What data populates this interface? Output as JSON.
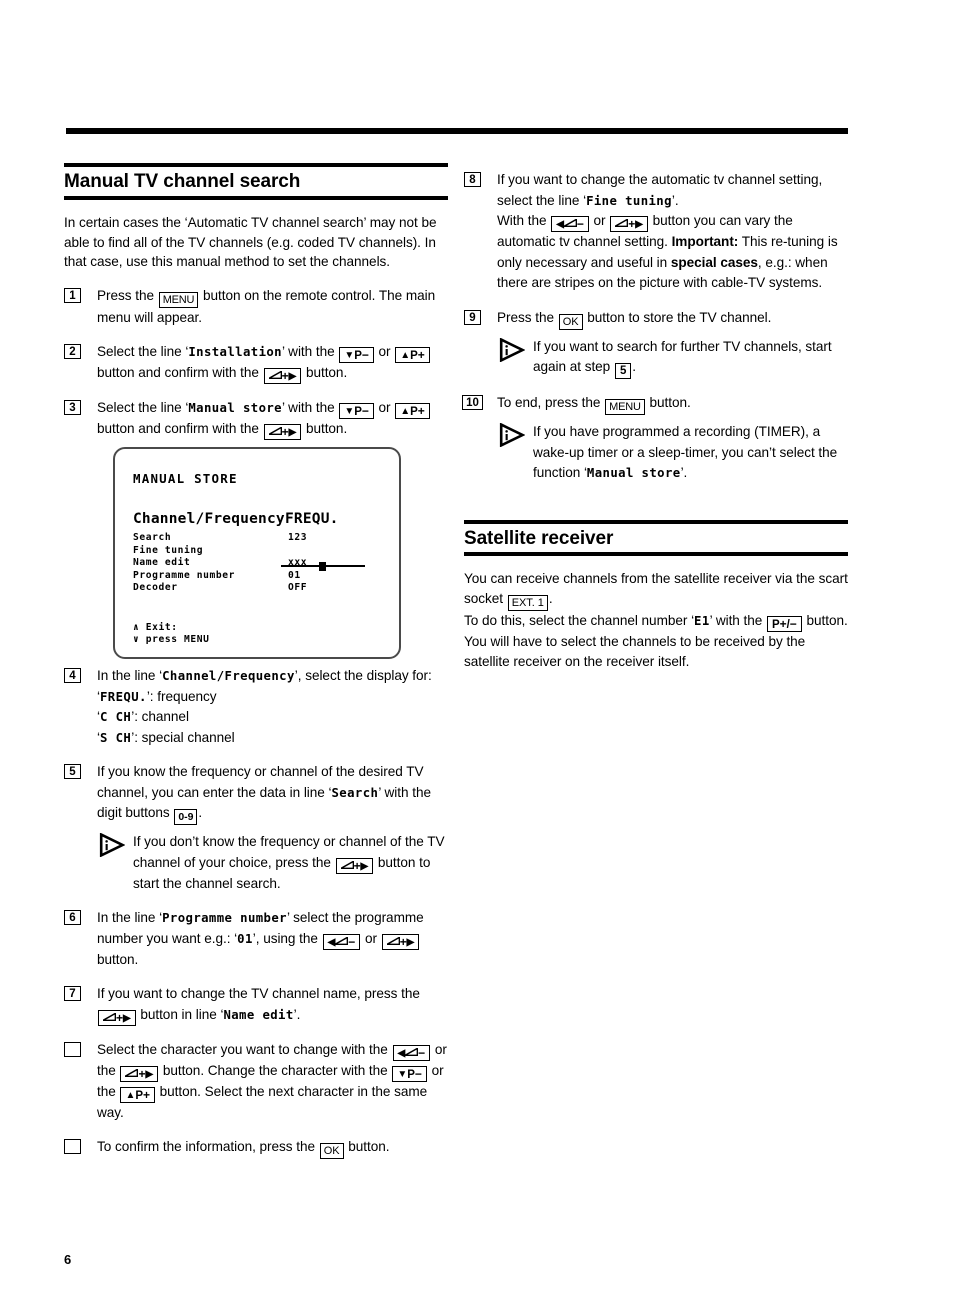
{
  "page_number": "6",
  "left_column": {
    "heading": "Manual TV channel search",
    "intro": "In certain cases the ‘Automatic TV channel search’ may not be able to find all of the TV channels (e.g. coded TV channels). In that case, use this manual method to set the channels.",
    "steps": [
      {
        "num": "1",
        "parts": [
          {
            "t": "text",
            "v": "Press the "
          },
          {
            "t": "key",
            "v": "MENU",
            "style": "menu"
          },
          {
            "t": "text",
            "v": " button on the remote control. The main menu will appear."
          }
        ]
      },
      {
        "num": "2",
        "parts": [
          {
            "t": "text",
            "v": "Select the line ‘"
          },
          {
            "t": "mono",
            "v": "Installation"
          },
          {
            "t": "text",
            "v": "’ with the "
          },
          {
            "t": "key",
            "v": "▼P−",
            "style": "vol"
          },
          {
            "t": "text",
            "v": " or "
          },
          {
            "t": "key",
            "v": "▲P+",
            "style": "vol"
          },
          {
            "t": "text",
            "v": " button and confirm with the "
          },
          {
            "t": "key",
            "v": "⊿+▶",
            "style": "vol"
          },
          {
            "t": "text",
            "v": " button."
          }
        ]
      },
      {
        "num": "3",
        "parts": [
          {
            "t": "text",
            "v": "Select the line ‘"
          },
          {
            "t": "mono",
            "v": "Manual store"
          },
          {
            "t": "text",
            "v": "’ with the "
          },
          {
            "t": "key",
            "v": "▼P−",
            "style": "vol"
          },
          {
            "t": "text",
            "v": " or "
          },
          {
            "t": "key",
            "v": "▲P+",
            "style": "vol"
          },
          {
            "t": "text",
            "v": " button and confirm with the "
          },
          {
            "t": "key",
            "v": "⊿+▶",
            "style": "vol"
          },
          {
            "t": "text",
            "v": " button."
          }
        ]
      }
    ],
    "steps_after_figure": [
      {
        "num": "4",
        "lines": [
          "In the line ‘Channel/Frequency’, select the display for:",
          "‘FREQU.’: frequency",
          "‘C CH’: channel",
          "‘S CH’: special channel"
        ]
      },
      {
        "num": "5"
      },
      {
        "num": "6"
      },
      {
        "num": "7"
      },
      {
        "num": ""
      },
      {
        "num": ""
      }
    ],
    "step4": {
      "lead": "In the line ‘",
      "mono1": "Channel/Frequency",
      "after": "’, select the display for:",
      "opt1_mono": "FREQU.",
      "opt1_text": ": frequency",
      "opt2_mono": "C  CH",
      "opt2_text": ": channel",
      "opt3_mono": "S  CH",
      "opt3_text": ": special channel"
    },
    "step5": {
      "a": "If you know the frequency or channel of the desired TV channel, you can enter the data in line ‘",
      "mono": "Search",
      "b": "’ with the digit buttons ",
      "key": "0-9",
      "c": ".",
      "note_a": "If you don’t know the frequency or channel of the TV channel of your choice, press the ",
      "note_key": "⊿+▶",
      "note_b": " button to start the channel search."
    },
    "step6": {
      "a": "In the line ‘",
      "mono": "Programme number",
      "b": "’ select the programme number you want e.g.: ‘",
      "value_mono": "01",
      "c": "’, using the ",
      "key1": "◀⊿−",
      "d": " or ",
      "key2": "⊿+▶",
      "e": " button."
    },
    "step7": {
      "a": "If you want to change the TV channel name, press the ",
      "key1": "⊿+▶",
      "b": " button in line ‘",
      "mono": "Name edit",
      "c": "’."
    },
    "bullet1": {
      "a": "Select the character you want to change with the ",
      "key1": "◀⊿−",
      "b": " or the ",
      "key2": "⊿+▶",
      "c": " button. Change the character with the ",
      "key3": "▼P−",
      "d": " or the ",
      "key4": "▲P+",
      "e": " button. Select the next character in the same way."
    },
    "bullet2": {
      "a": "To confirm the information, press the ",
      "key1": "OK",
      "b": " button."
    }
  },
  "tv_figure": {
    "title": "MANUAL STORE",
    "main_row": {
      "label": "Channel/Frequency",
      "value": "FREQU."
    },
    "rows": [
      {
        "label": "Search",
        "value": "123"
      },
      {
        "label": "Fine tuning",
        "value": "slider"
      },
      {
        "label": "Name edit",
        "value": "xxx"
      },
      {
        "label": "Programme number",
        "value": "01"
      },
      {
        "label": "Decoder",
        "value": "OFF"
      }
    ],
    "exit_line1": "∧ Exit:",
    "exit_line2": "∨ press MENU"
  },
  "right_column": {
    "step8": {
      "num": "8",
      "a": "If you want to change the automatic tv channel setting, select the line ‘",
      "mono": "Fine tuning",
      "b": "’.",
      "c": "With the ",
      "key1": "◀⊿−",
      "d": " or ",
      "key2": "⊿+▶",
      "e": " button you can vary the automatic tv channel setting. ",
      "bold1": "Important:",
      "f": " This re-tuning is only necessary and useful in ",
      "bold2": "special cases",
      "g": ", e.g.: when there are stripes on the picture with cable-TV systems."
    },
    "step9": {
      "num": "9",
      "a": "Press the ",
      "key1": "OK",
      "b": " button to store the TV channel.",
      "note_a": "If you want to search for further TV channels, start again at step ",
      "note_key": "5",
      "note_b": "."
    },
    "step10": {
      "num": "10",
      "a": "To end, press the ",
      "key1": "MENU",
      "b": " button.",
      "note_a": "If you have programmed a recording (TIMER), a wake-up timer or a sleep-timer, you can’t select the function ‘",
      "note_mono": "Manual store",
      "note_b": "’."
    },
    "satellite": {
      "heading": "Satellite receiver",
      "p1_a": "You can receive channels from the satellite receiver via the scart socket ",
      "p1_key": "EXT. 1",
      "p1_b": ".",
      "p2_a": "To do this, select the channel number ‘",
      "p2_mono": "E1",
      "p2_b": "’ with the ",
      "p2_key": "P+/−",
      "p2_c": " button. You will have to select the channels to be received by the satellite receiver on the receiver itself."
    }
  }
}
